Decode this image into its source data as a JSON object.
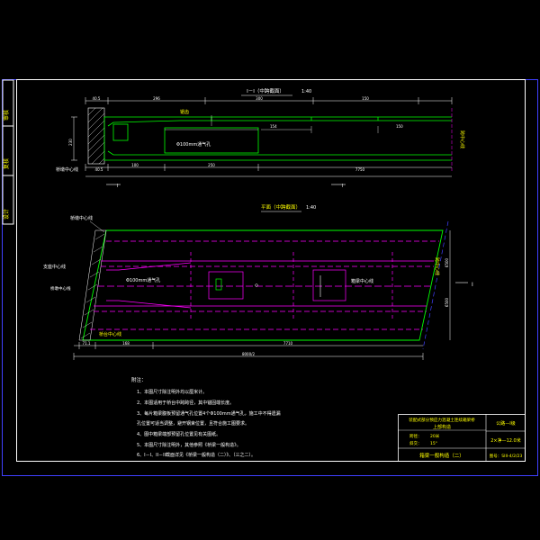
{
  "side_bar": {
    "labels": [
      "审核",
      "复核",
      "设计"
    ]
  },
  "section_view": {
    "title": "I－I（中跨截面）",
    "scale": "1:40",
    "dims_top": [
      "40.5",
      "296",
      "300",
      "150"
    ],
    "dims_mid": [
      "154",
      "150"
    ],
    "dims_height": "230",
    "dims_bottom_a": "40.5",
    "dims_bottom_b": "100",
    "dims_bottom_c": "250",
    "dims_bottom_d": "7750",
    "label_haunch": "锯齿",
    "label_hole": "Φ100mm通气孔",
    "label_left": "桥墩中心线",
    "label_right_vertical": "跨中心线",
    "label_cut": "I"
  },
  "plan_view": {
    "title": "平面（中跨截面）",
    "scale": "1:40",
    "label_pier_center": "桥墩中心线",
    "label_support_center": "支座中心线",
    "label_top": "桥墩中心线",
    "label_hole": "Φ100mm通气孔",
    "label_box_center": "箱梁中心线",
    "label_bottom": "桥台中心线",
    "label_span_center": "跨中心线",
    "dims_bottom": [
      "71.1",
      "168",
      "7710"
    ],
    "dims_total": "8000/2",
    "dims_right": [
      "6500",
      "6500"
    ],
    "label_cut": "I"
  },
  "notes": {
    "heading": "附注：",
    "items": [
      "1、本图尺寸除注明外均以厘米计。",
      "2、本图适用于桥台中跨跨径，其中锚固端长度。",
      "3、每片箱梁腹板预留通气孔位置4个Φ100mm通气孔，施工中不得遗漏",
      "   孔位置可适当调整，避开钢束位置，且符合施工图要求。",
      "4、图中箱梁端部预留孔位置见有关图纸。",
      "5、本图尺寸除注明外，其他参照《桥梁一般构造》。",
      "6、I－I、II－II截面详见《桥梁一般构造（二）》、（三之二）。"
    ]
  },
  "title_block": {
    "project": "装配式部分预应力混凝土连续箱梁桥",
    "part": "上部构造",
    "span_label": "跨径：",
    "span_value": "20米",
    "skew_label": "斜交：",
    "skew_value": "15°",
    "drawing_name": "箱梁一般构造（二）",
    "load_class": "公路—I级",
    "width_code": "2×净—12.0米",
    "drawing_no": "图号：SIII-4/2/23"
  },
  "colors": {
    "frame": "#ffffff",
    "dimension": "#ffffff",
    "structure": "#00ff00",
    "centerline": "#ff00ff",
    "title_text": "#ffff00",
    "border": "#4040ff",
    "label": "#ffff00"
  }
}
